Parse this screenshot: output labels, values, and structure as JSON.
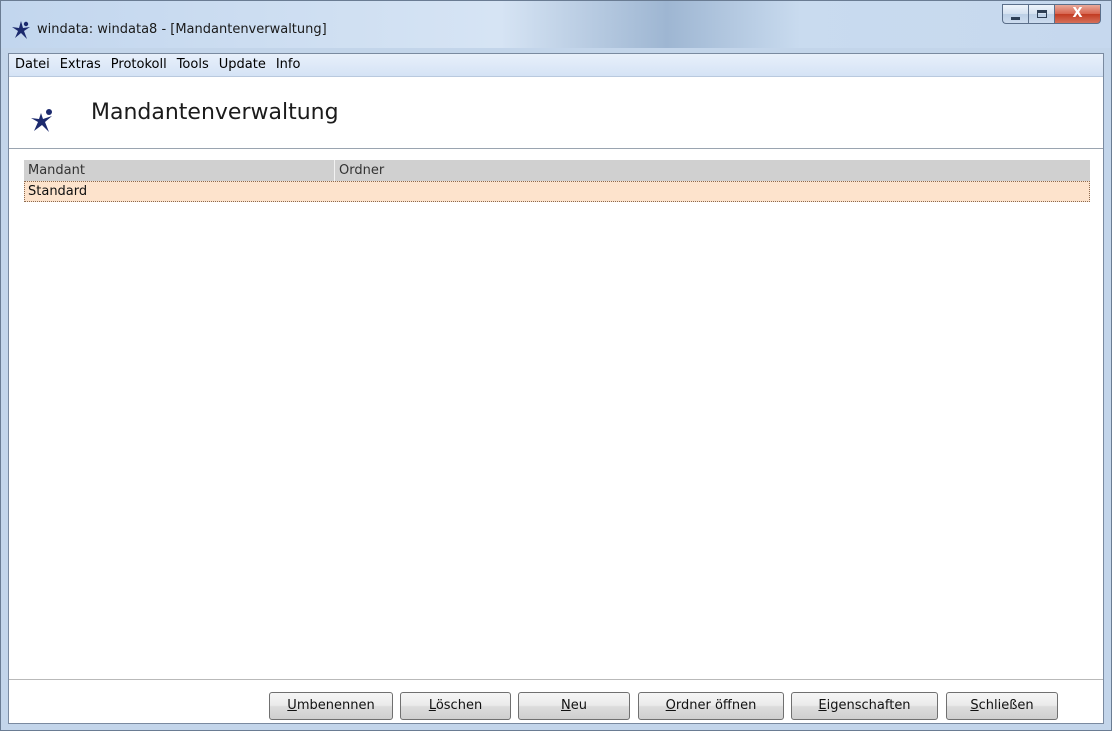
{
  "window": {
    "title": "windata: windata8 - [Mandantenverwaltung]",
    "controls": {
      "minimize": "–",
      "maximize": "□",
      "close": "X"
    }
  },
  "menu": [
    {
      "label": "Datei"
    },
    {
      "label": "Extras"
    },
    {
      "label": "Protokoll"
    },
    {
      "label": "Tools"
    },
    {
      "label": "Update"
    },
    {
      "label": "Info"
    }
  ],
  "header": {
    "title": "Mandantenverwaltung",
    "icon": "star-figure-icon"
  },
  "list": {
    "columns": [
      "Mandant",
      "Ordner"
    ],
    "rows": [
      {
        "mandant": "Standard",
        "ordner": "",
        "selected": true
      }
    ]
  },
  "buttons": {
    "rename": {
      "mnemonic": "U",
      "rest": "mbenennen"
    },
    "delete": {
      "mnemonic": "L",
      "rest": "öschen"
    },
    "new": {
      "mnemonic": "N",
      "rest": "eu"
    },
    "open_folder": {
      "mnemonic": "O",
      "rest": "rdner öffnen"
    },
    "properties": {
      "mnemonic": "E",
      "rest": "igenschaften"
    },
    "close": {
      "mnemonic": "S",
      "rest": "chließen"
    }
  },
  "colors": {
    "selected_row": "#fde3cc",
    "column_header": "#d0d0d0",
    "close_button": "#c23b22"
  }
}
